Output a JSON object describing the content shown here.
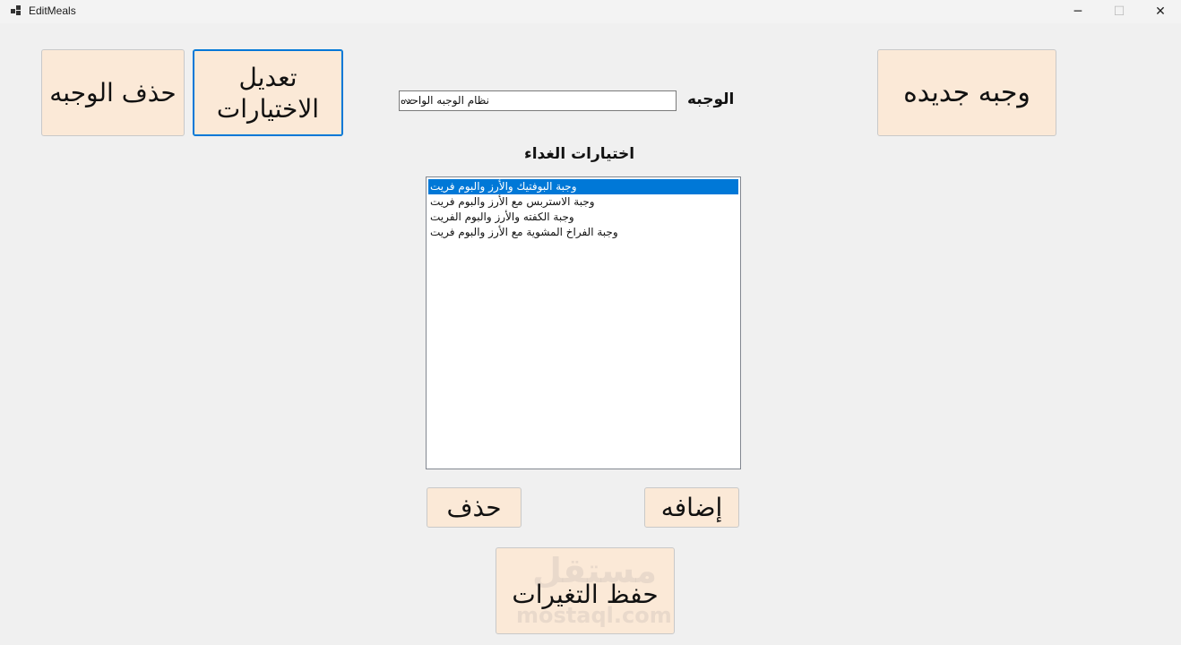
{
  "window": {
    "title": "EditMeals",
    "icon": "app-window-icon"
  },
  "controls": {
    "minimize": "─",
    "maximize": "☐",
    "close": "✕"
  },
  "buttons": {
    "delete_meal": "حذف الوجبه",
    "edit_choices": "تعديل الاختيارات",
    "new_meal": "وجبه جديده",
    "delete": "حذف",
    "add": "إضافه",
    "save_changes": "حفظ التغيرات"
  },
  "meal_selector": {
    "label": "الوجبه",
    "selected": "نظام الوجبه الواحده"
  },
  "lunch_choices": {
    "label": "اختيارات الغداء",
    "items": [
      "وجبة البوفتيك والأرز والبوم فريت",
      "وجبة الاستربس مع الأرز والبوم فريت",
      "وجبة الكفته والأرز والبوم الفريت",
      "وجبة الفراخ المشوية مع الأرز والبوم فريت"
    ],
    "selected_index": 0
  },
  "watermark": {
    "arabic": "مستقل",
    "latin": "mostaql.com"
  },
  "colors": {
    "button_bg": "#fbe9d7",
    "selection": "#0078d7",
    "focus_border": "#0078d7",
    "background": "#f0f0f0"
  }
}
